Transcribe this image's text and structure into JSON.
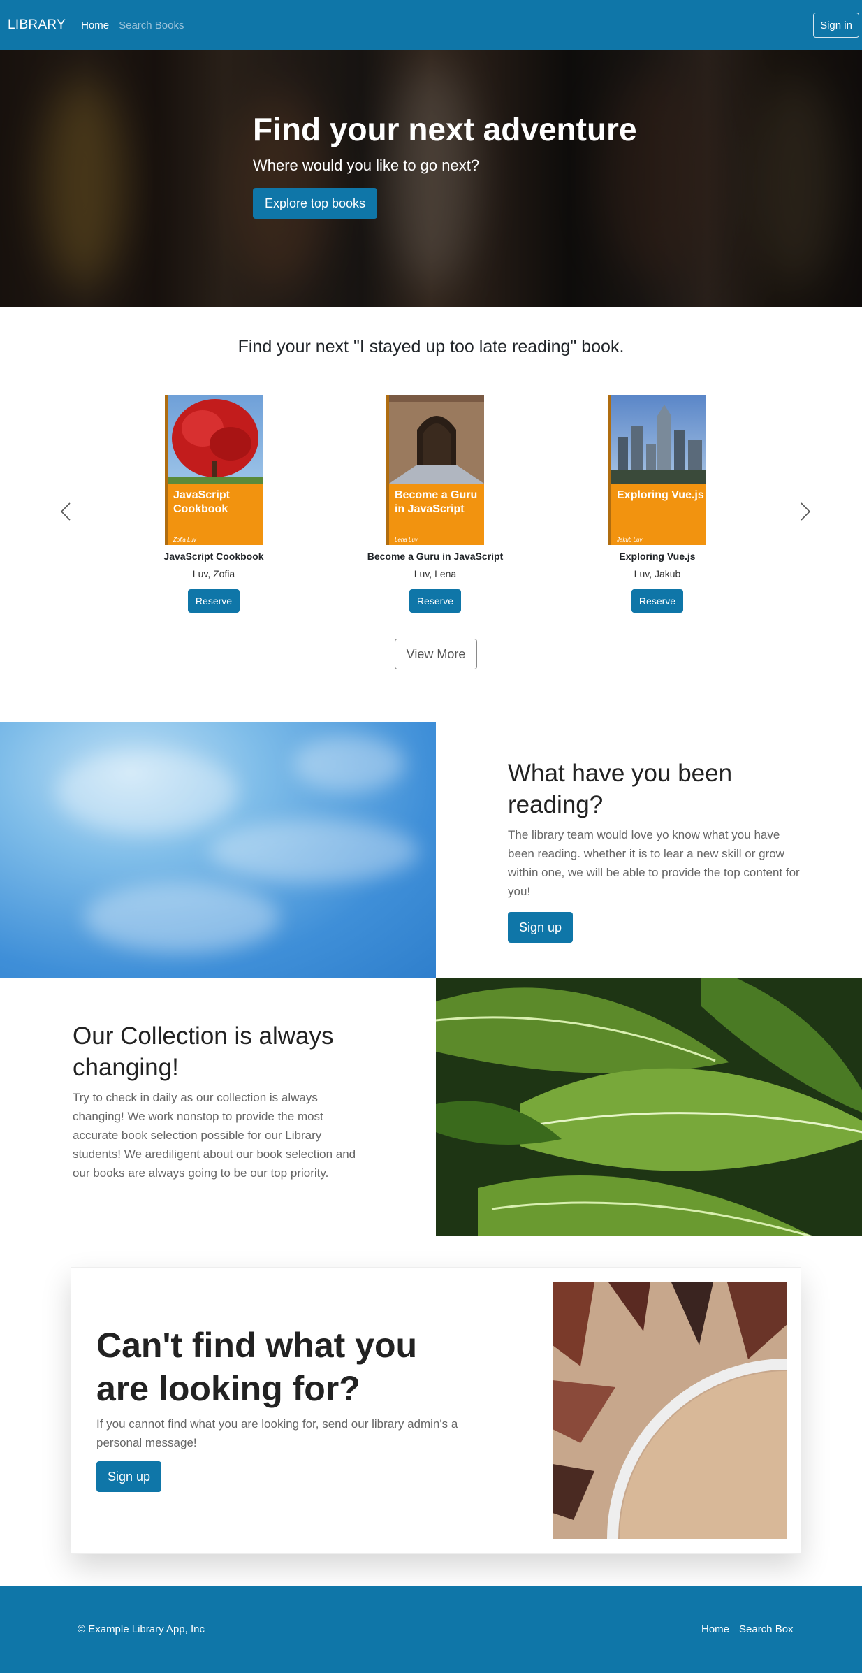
{
  "navbar": {
    "brand": "LIBRARY",
    "links": [
      {
        "label": "Home",
        "active": true
      },
      {
        "label": "Search Books",
        "active": false
      }
    ],
    "signin_label": "Sign in",
    "color": "#0f76a8"
  },
  "hero": {
    "title": "Find your next adventure",
    "subtitle": "Where would you like to go next?",
    "button_label": "Explore top books"
  },
  "books": {
    "heading": "Find your next \"I stayed up too late reading\" book.",
    "prev_icon": "chevron-left-icon",
    "next_icon": "chevron-right-icon",
    "items": [
      {
        "cover_title": "JavaScript Cookbook",
        "cover_author": "Zofia Luv",
        "title": "JavaScript Cookbook",
        "author": "Luv, Zofia",
        "button_label": "Reserve"
      },
      {
        "cover_title": "Become a Guru in JavaScript",
        "cover_author": "Lena Luv",
        "title": "Become a Guru in JavaScript",
        "author": "Luv, Lena",
        "button_label": "Reserve"
      },
      {
        "cover_title": "Exploring Vue.js",
        "cover_author": "Jakub Luv",
        "title": "Exploring Vue.js",
        "author": "Luv, Jakub",
        "button_label": "Reserve"
      }
    ],
    "view_more_label": "View More"
  },
  "feature_reading": {
    "title": "What have you been reading?",
    "text": "The library team would love yo know what you have been reading. whether it is to lear a new skill or grow within one, we will be able to provide the top content for you!",
    "button_label": "Sign up"
  },
  "feature_collection": {
    "title": "Our Collection is always changing!",
    "text": "Try to check in daily as our collection is always changing! We work nonstop to provide the most accurate book selection possible for our Library students! We arediligent about our book selection and our books are always going to be our top priority."
  },
  "cta": {
    "title": "Can't find what you are looking for?",
    "text": "If you cannot find what you are looking for, send our library admin's a personal message!",
    "button_label": "Sign up"
  },
  "footer": {
    "copyright": "© Example Library App, Inc",
    "links": [
      "Home",
      "Search Box"
    ]
  }
}
